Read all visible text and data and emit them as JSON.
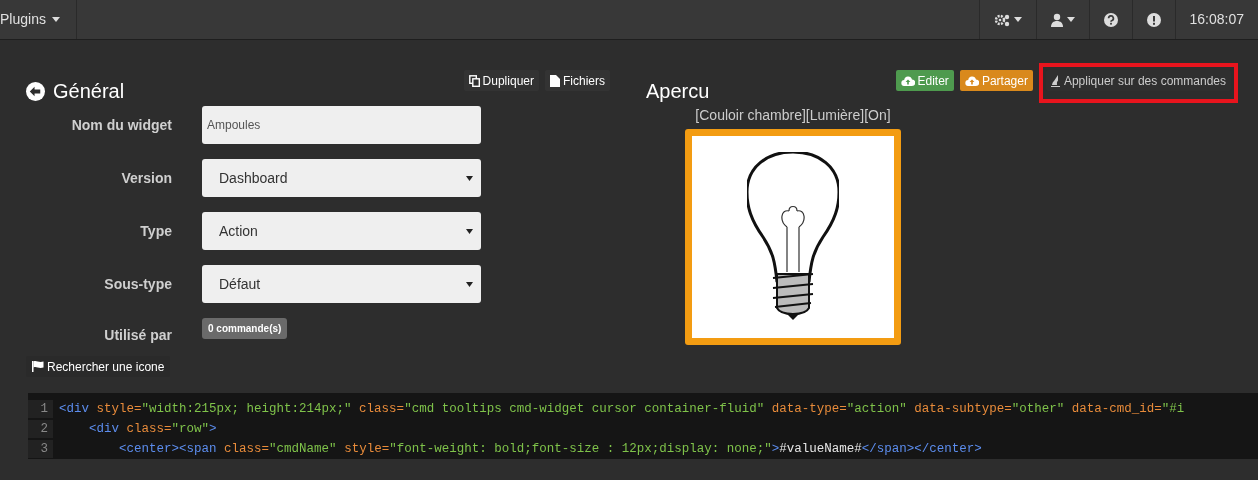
{
  "navbar": {
    "menu": "Plugins",
    "icons": [
      {
        "kind": "gears",
        "caret": true
      },
      {
        "kind": "user",
        "caret": true
      },
      {
        "kind": "help",
        "caret": false
      },
      {
        "kind": "alert",
        "caret": false
      }
    ],
    "time": "16:08:07"
  },
  "general": {
    "title": "Général",
    "actions": [
      {
        "kind": "copy",
        "label": "Dupliquer"
      },
      {
        "kind": "file",
        "label": "Fichiers"
      }
    ],
    "fields": [
      {
        "kind": "input",
        "label": "Nom du widget",
        "value": "Ampoules"
      },
      {
        "kind": "select",
        "label": "Version",
        "value": "Dashboard"
      },
      {
        "kind": "select",
        "label": "Type",
        "value": "Action"
      },
      {
        "kind": "select",
        "label": "Sous-type",
        "value": "Défaut"
      },
      {
        "kind": "badge",
        "label": "Utilisé par",
        "value": "0 commande(s)"
      }
    ],
    "search_icon_button": "Rechercher une icone"
  },
  "preview": {
    "title": "Apercu",
    "actions": [
      {
        "kind": "edit",
        "label": "Editer",
        "color": "#4e9a4e",
        "highlighted": false
      },
      {
        "kind": "share",
        "label": "Partager",
        "color": "#d9891c",
        "highlighted": false
      },
      {
        "kind": "apply",
        "label": "Appliquer sur des commandes",
        "color": "#2f2f2f",
        "highlighted": true
      }
    ],
    "widget_name": "[Couloir chambre][Lumière][On]"
  },
  "code_editor": {
    "lines": [
      {
        "number": "1",
        "text": "<div style=\"width:215px; height:214px;\" class=\"cmd tooltips cmd-widget cursor container-fluid\" data-type=\"action\" data-subtype=\"other\" data-cmd_id=\"#i"
      },
      {
        "number": "2",
        "text": "    <div class=\"row\">"
      },
      {
        "number": "3",
        "text": "        <center><span class=\"cmdName\" style=\"font-weight: bold;font-size : 12px;display: none;\">#valueName#</span></center>"
      }
    ]
  }
}
